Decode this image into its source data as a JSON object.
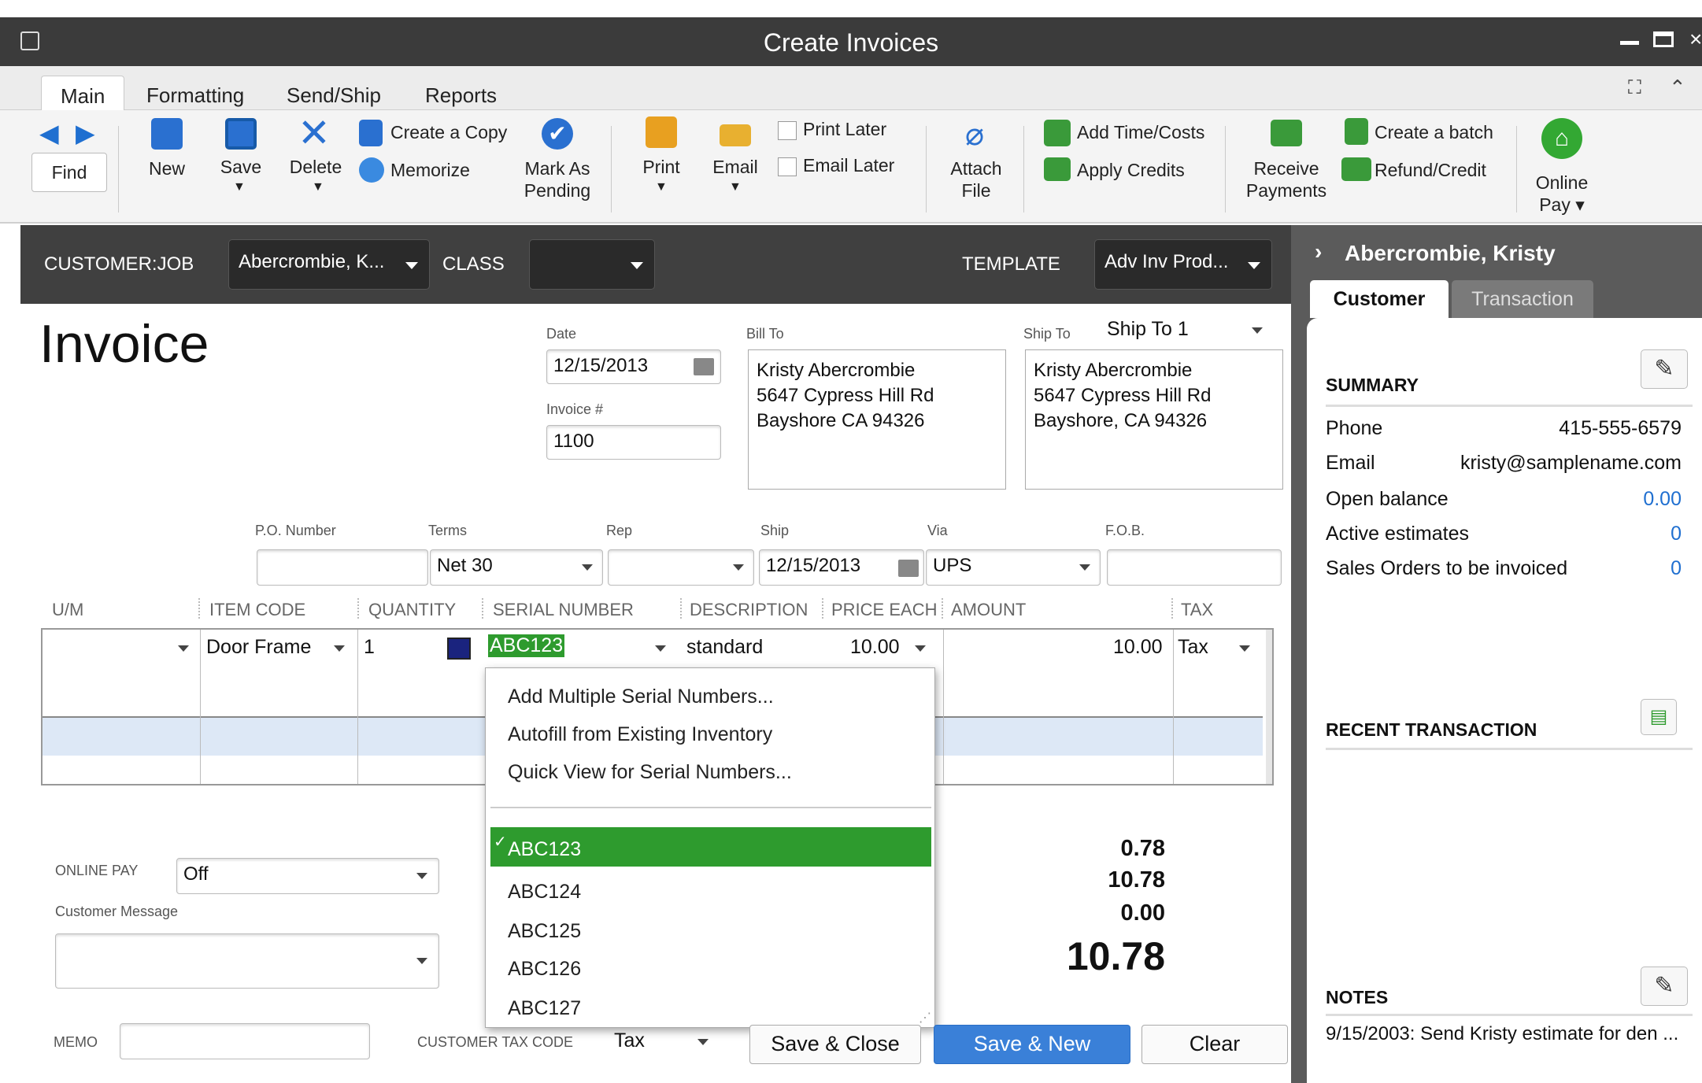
{
  "window": {
    "title": "Create Invoices"
  },
  "tabs": [
    "Main",
    "Formatting",
    "Send/Ship",
    "Reports"
  ],
  "toolbar": {
    "find": "Find",
    "new": "New",
    "save": "Save",
    "delete": "Delete",
    "create_copy": "Create a Copy",
    "memorize": "Memorize",
    "mark_as": "Mark As",
    "pending": "Pending",
    "print": "Print",
    "email": "Email",
    "print_later": "Print Later",
    "email_later": "Email Later",
    "attach": "Attach",
    "file": "File",
    "add_time": "Add Time/Costs",
    "apply_credits": "Apply Credits",
    "receive": "Receive",
    "payments": "Payments",
    "create_batch": "Create a batch",
    "refund": "Refund/Credit",
    "online": "Online",
    "pay": "Pay ▾"
  },
  "header": {
    "customer_label": "CUSTOMER:JOB",
    "customer_value": "Abercrombie, K...",
    "class_label": "CLASS",
    "class_value": "",
    "template_label": "TEMPLATE",
    "template_value": "Adv Inv Prod..."
  },
  "invoice": {
    "title": "Invoice",
    "date_label": "Date",
    "date": "12/15/2013",
    "invoice_no_label": "Invoice #",
    "invoice_no": "1100",
    "bill_to_label": "Bill To",
    "bill_to": [
      "Kristy Abercrombie",
      "5647 Cypress Hill Rd",
      "Bayshore CA 94326"
    ],
    "ship_to_label": "Ship To",
    "ship_to_select": "Ship To 1",
    "ship_to": [
      "Kristy Abercrombie",
      "5647 Cypress Hill Rd",
      "Bayshore, CA 94326"
    ]
  },
  "fields": {
    "po_label": "P.O. Number",
    "po": "",
    "terms_label": "Terms",
    "terms": "Net 30",
    "rep_label": "Rep",
    "rep": "",
    "ship_label": "Ship",
    "ship": "12/15/2013",
    "via_label": "Via",
    "via": "UPS",
    "fob_label": "F.O.B.",
    "fob": ""
  },
  "columns": [
    "U/M",
    "ITEM CODE",
    "QUANTITY",
    "SERIAL NUMBER",
    "DESCRIPTION",
    "PRICE EACH",
    "AMOUNT",
    "TAX"
  ],
  "line": {
    "item": "Door Frame",
    "qty": "1",
    "serial": "ABC123",
    "desc": "standard",
    "price": "10.00",
    "amount": "10.00",
    "tax": "Tax"
  },
  "serial_menu": {
    "actions": [
      "Add Multiple Serial Numbers...",
      "Autofill from Existing Inventory",
      "Quick View for Serial Numbers..."
    ],
    "options": [
      "ABC123",
      "ABC124",
      "ABC125",
      "ABC126",
      "ABC127"
    ],
    "selected": "ABC123",
    "check": "✓"
  },
  "totals": {
    "tax": "0.78",
    "total": "10.78",
    "payments": "0.00",
    "balance": "10.78"
  },
  "bottom": {
    "online_pay_label": "ONLINE PAY",
    "online_pay": "Off",
    "customer_message_label": "Customer Message",
    "memo_label": "MEMO",
    "cust_tax_label": "CUSTOMER TAX CODE",
    "cust_tax": "Tax",
    "save_close": "Save & Close",
    "save_new": "Save & New",
    "clear": "Clear"
  },
  "panel": {
    "name": "Abercrombie, Kristy",
    "tab_customer": "Customer",
    "tab_transaction": "Transaction",
    "summary": "SUMMARY",
    "rows": [
      {
        "label": "Phone",
        "value": "415-555-6579"
      },
      {
        "label": "Email",
        "value": "kristy@samplename.com"
      },
      {
        "label": "Open balance",
        "value": "0.00"
      },
      {
        "label": "Active estimates",
        "value": "0"
      },
      {
        "label": "Sales Orders to be invoiced",
        "value": "0"
      }
    ],
    "recent": "RECENT TRANSACTION",
    "notes": "NOTES",
    "note_text": "9/15/2003:  Send Kristy estimate for den ..."
  },
  "colors": {
    "accent": "#1f7be0",
    "selected_green": "#2e9b2e",
    "header_dark": "#404040"
  }
}
